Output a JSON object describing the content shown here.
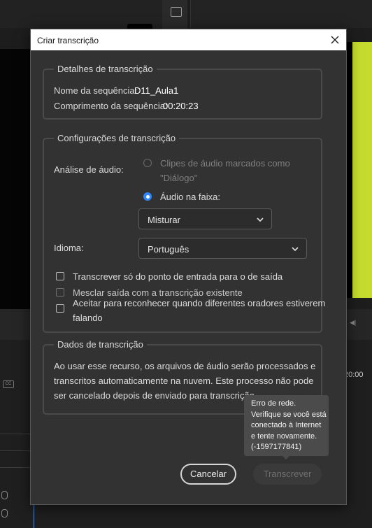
{
  "dialog": {
    "title": "Criar transcrição",
    "close_icon": "close-icon"
  },
  "details": {
    "legend": "Detalhes de transcrição",
    "sequence_name_label": "Nome da sequência:",
    "sequence_name_value": "D11_Aula1",
    "sequence_length_label": "Comprimento da sequência:",
    "sequence_length_value": "00:20:23"
  },
  "settings": {
    "legend": "Configurações de transcrição",
    "audio_analysis_label": "Análise de áudio:",
    "option_marked_clips_line1": "Clipes de áudio marcados como",
    "option_marked_clips_line2": "\"Diálogo\"",
    "option_marked_clips_selected": false,
    "option_marked_clips_enabled": false,
    "option_track_audio": "Áudio na faixa:",
    "option_track_audio_selected": true,
    "track_select_value": "Misturar",
    "language_label": "Idioma:",
    "language_select_value": "Português",
    "checkbox_in_out": "Transcrever só do ponto de entrada para o de saída",
    "checkbox_merge": "Mesclar saída com a transcrição existente",
    "checkbox_speakers_line1": "Aceitar para reconhecer quando diferentes oradores estiverem",
    "checkbox_speakers_line2": "falando"
  },
  "data_section": {
    "legend": "Dados de transcrição",
    "line1": "Ao usar esse recurso, os arquivos de áudio serão processados e",
    "line2": "transcritos automaticamente na nuvem. Este processo não pode",
    "line3": "ser cancelado depois de enviado para transcrição."
  },
  "buttons": {
    "cancel": "Cancelar",
    "transcribe": "Transcrever"
  },
  "tooltip": {
    "line1": "Erro de rede.",
    "line2": "Verifique se você está",
    "line3": "conectado à Internet",
    "line4": "e tente novamente.",
    "line5": "(-1597177841)"
  },
  "background": {
    "timecode": "20:00",
    "cc_label": "CC"
  },
  "colors": {
    "accent": "#2f86ff",
    "dialog_bg": "#323232",
    "program_monitor_green": "#c5dc2e",
    "clip_blue": "#3d73b0"
  }
}
